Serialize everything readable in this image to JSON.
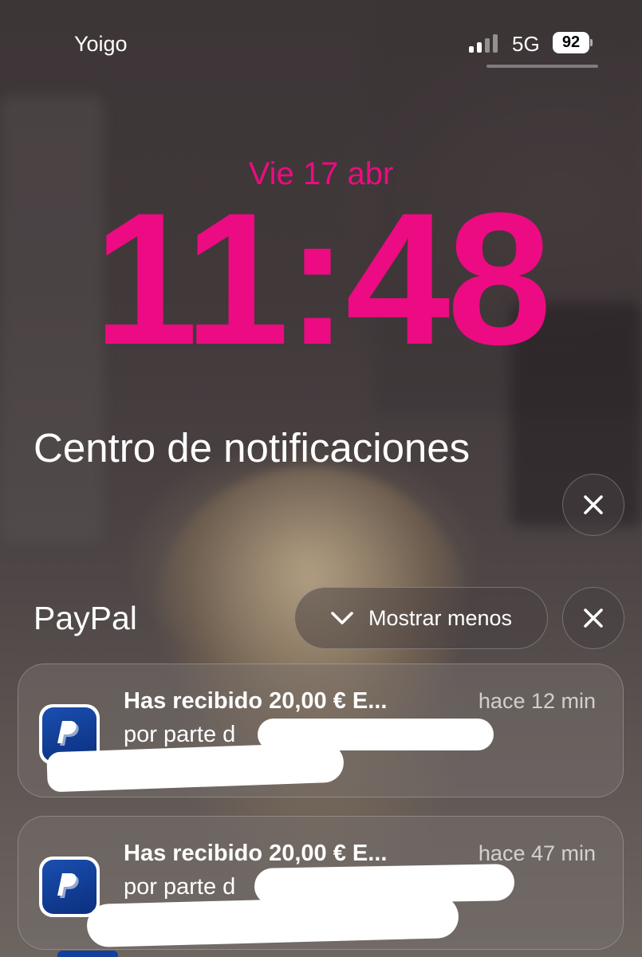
{
  "status_bar": {
    "carrier": "Yoigo",
    "network": "5G",
    "battery": "92",
    "signal_bars_filled": 2,
    "signal_bars_total": 4
  },
  "lock_screen": {
    "date": "Vie 17 abr",
    "time": "11:48",
    "accent_color": "#ec0b82"
  },
  "notification_center": {
    "title": "Centro de notificaciones",
    "clear_all_icon": "close-icon"
  },
  "group": {
    "app_name": "PayPal",
    "show_less_label": "Mostrar menos",
    "show_less_icon": "chevron-down-icon",
    "clear_group_icon": "close-icon"
  },
  "notifications": [
    {
      "title": "Has recibido 20,00 € E...",
      "time_ago": "hace 12 min",
      "body": "por parte d",
      "icon": "paypal-icon"
    },
    {
      "title": "Has recibido 20,00 € E...",
      "time_ago": "hace 47 min",
      "body": "por parte d",
      "icon": "paypal-icon"
    }
  ]
}
